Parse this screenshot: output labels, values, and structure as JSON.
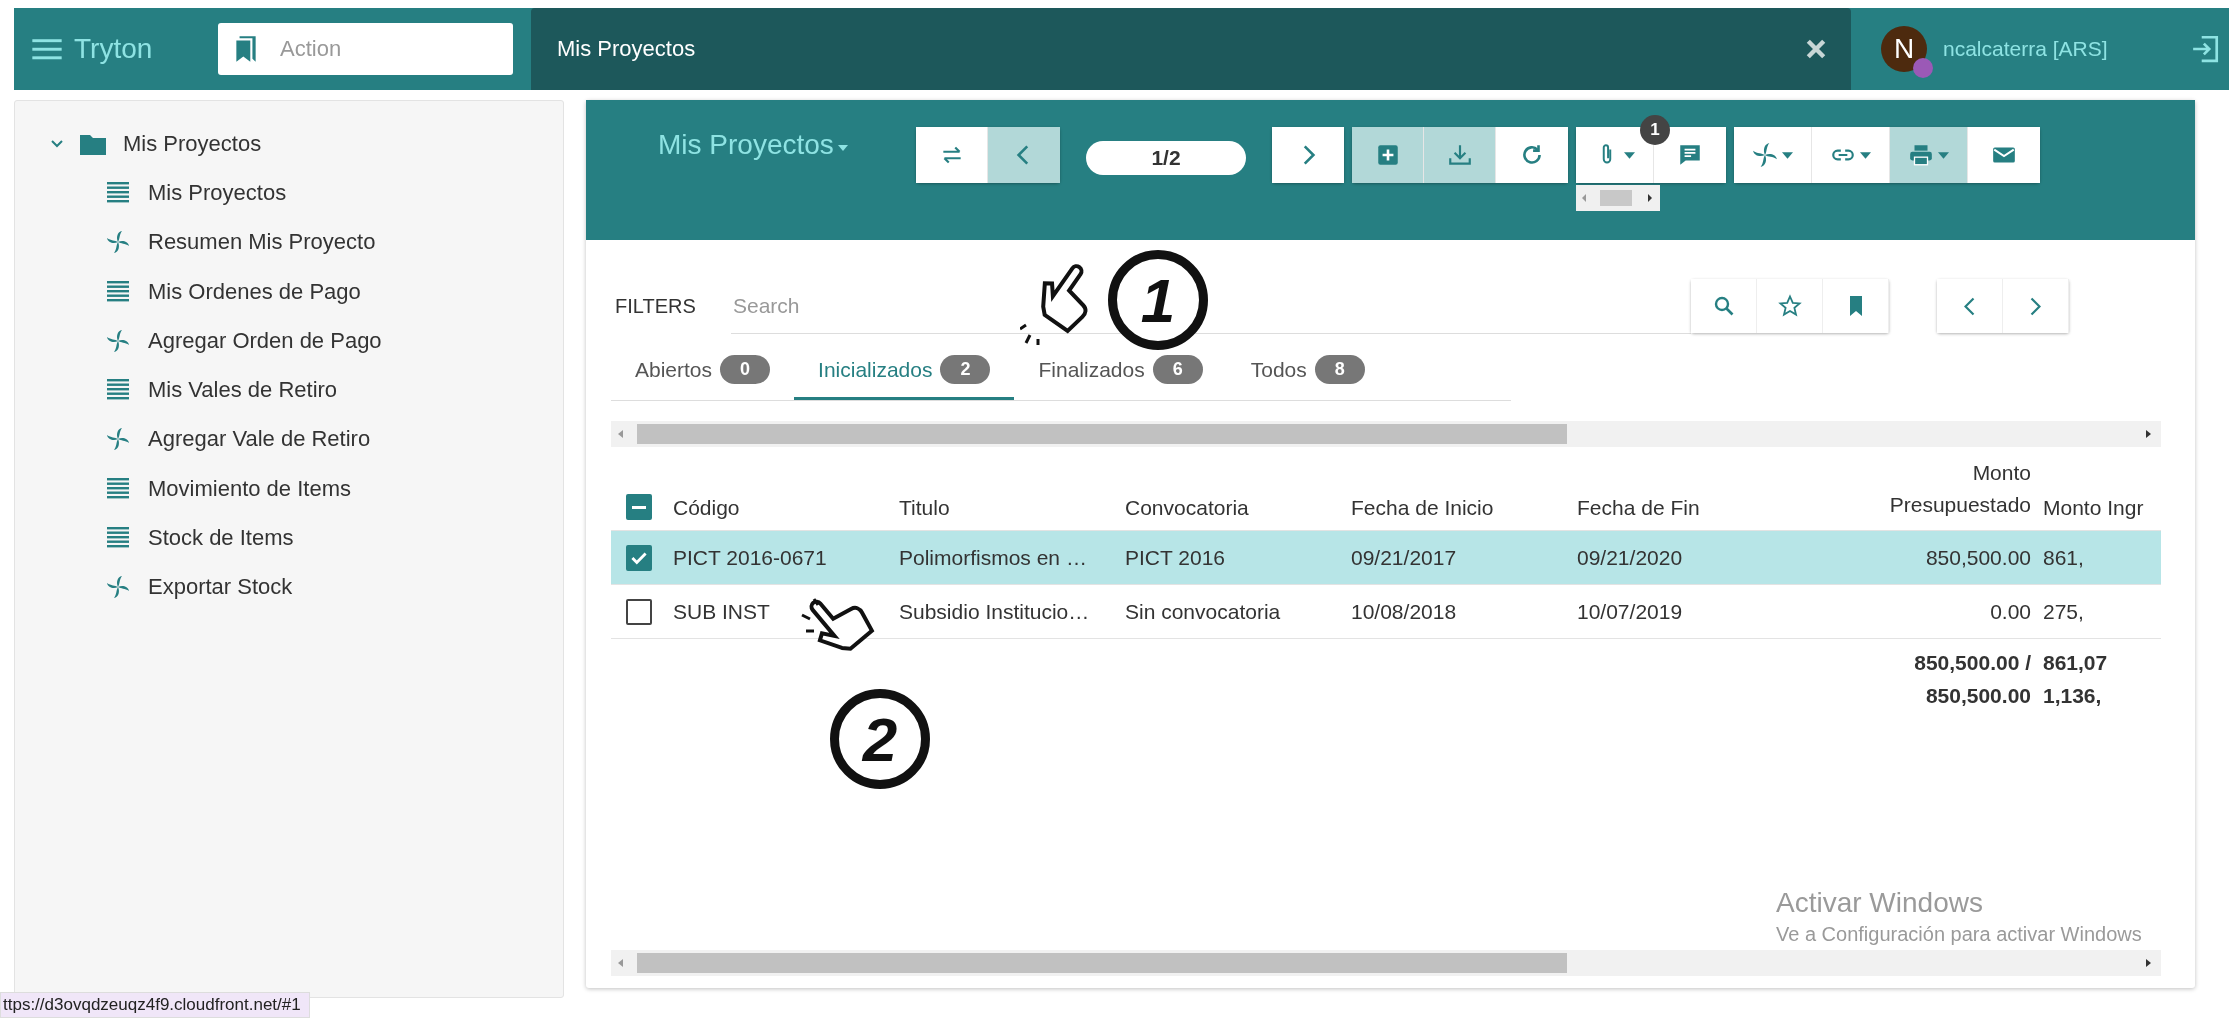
{
  "topbar": {
    "app_name": "Tryton",
    "action_search": {
      "placeholder": "Action"
    },
    "open_tab": {
      "title": "Mis Proyectos"
    },
    "user": {
      "avatar_letter": "N",
      "name": "ncalcaterra [ARS]"
    }
  },
  "sidebar": {
    "tree": [
      {
        "label": "Mis Proyectos",
        "kind": "folder",
        "expanded": true,
        "children": [
          {
            "label": "Mis Proyectos",
            "kind": "list"
          },
          {
            "label": "Resumen Mis Proyecto",
            "kind": "wizard"
          },
          {
            "label": "Mis Ordenes de Pago",
            "kind": "list"
          },
          {
            "label": "Agregar Orden de Pago",
            "kind": "wizard"
          },
          {
            "label": "Mis Vales de Retiro",
            "kind": "list"
          },
          {
            "label": "Agregar Vale de Retiro",
            "kind": "wizard"
          },
          {
            "label": "Movimiento de Items",
            "kind": "list"
          },
          {
            "label": "Stock de Items",
            "kind": "list"
          },
          {
            "label": "Exportar Stock",
            "kind": "wizard"
          }
        ]
      }
    ]
  },
  "header": {
    "title": "Mis Proyectos",
    "pager": "1/2",
    "toolbar_groups": [
      [
        {
          "kind": "switch",
          "disabled": false
        },
        {
          "kind": "previous",
          "disabled": true
        }
      ],
      [
        {
          "kind": "pager"
        }
      ],
      [
        {
          "kind": "next",
          "disabled": false
        }
      ],
      [
        {
          "kind": "new",
          "disabled": true
        },
        {
          "kind": "save",
          "disabled": true
        },
        {
          "kind": "reload",
          "disabled": false
        }
      ],
      [
        {
          "kind": "attachment",
          "disabled": false,
          "badge": "1"
        },
        {
          "kind": "note",
          "disabled": false
        }
      ],
      [
        {
          "kind": "action",
          "disabled": false
        },
        {
          "kind": "relate",
          "disabled": false
        },
        {
          "kind": "print",
          "disabled": true
        },
        {
          "kind": "email",
          "disabled": false
        }
      ]
    ]
  },
  "filters": {
    "label": "FILTERS",
    "placeholder": "Search"
  },
  "tabs": [
    {
      "label": "Abiertos",
      "count": "0",
      "selected": false
    },
    {
      "label": "Inicializados",
      "count": "2",
      "selected": true
    },
    {
      "label": "Finalizados",
      "count": "6",
      "selected": false
    },
    {
      "label": "Todos",
      "count": "8",
      "selected": false
    }
  ],
  "table": {
    "select_all": {
      "indeterminate": true
    },
    "columns": [
      {
        "label": "Código"
      },
      {
        "label": "Titulo"
      },
      {
        "label": "Convocatoria"
      },
      {
        "label": "Fecha de Inicio"
      },
      {
        "label": "Fecha de Fin"
      },
      {
        "label": "Monto Presupuestado",
        "total_lines": [
          "850,500.00 /",
          "850,500.00"
        ]
      },
      {
        "label": "Monto Ingr",
        "total_lines": [
          "861,07",
          "1,136,"
        ]
      }
    ],
    "rows": [
      {
        "selected": true,
        "cells": [
          "PICT 2016-0671",
          "Polimorfismos en …",
          "PICT 2016",
          "09/21/2017",
          "09/21/2020",
          "850,500.00",
          "861,"
        ]
      },
      {
        "selected": false,
        "cells": [
          "SUB INST",
          "Subsidio Institucio…",
          "Sin convocatoria",
          "10/08/2018",
          "10/07/2019",
          "0.00",
          "275,"
        ]
      }
    ]
  },
  "os_watermark": {
    "title": "Activar Windows",
    "subtitle": "Ve a Configuración para activar Windows"
  },
  "status_url": "ttps://d3ovqdzeuqz4f9.cloudfront.net/#1",
  "annotations": [
    {
      "number": "1"
    },
    {
      "number": "2"
    }
  ]
}
